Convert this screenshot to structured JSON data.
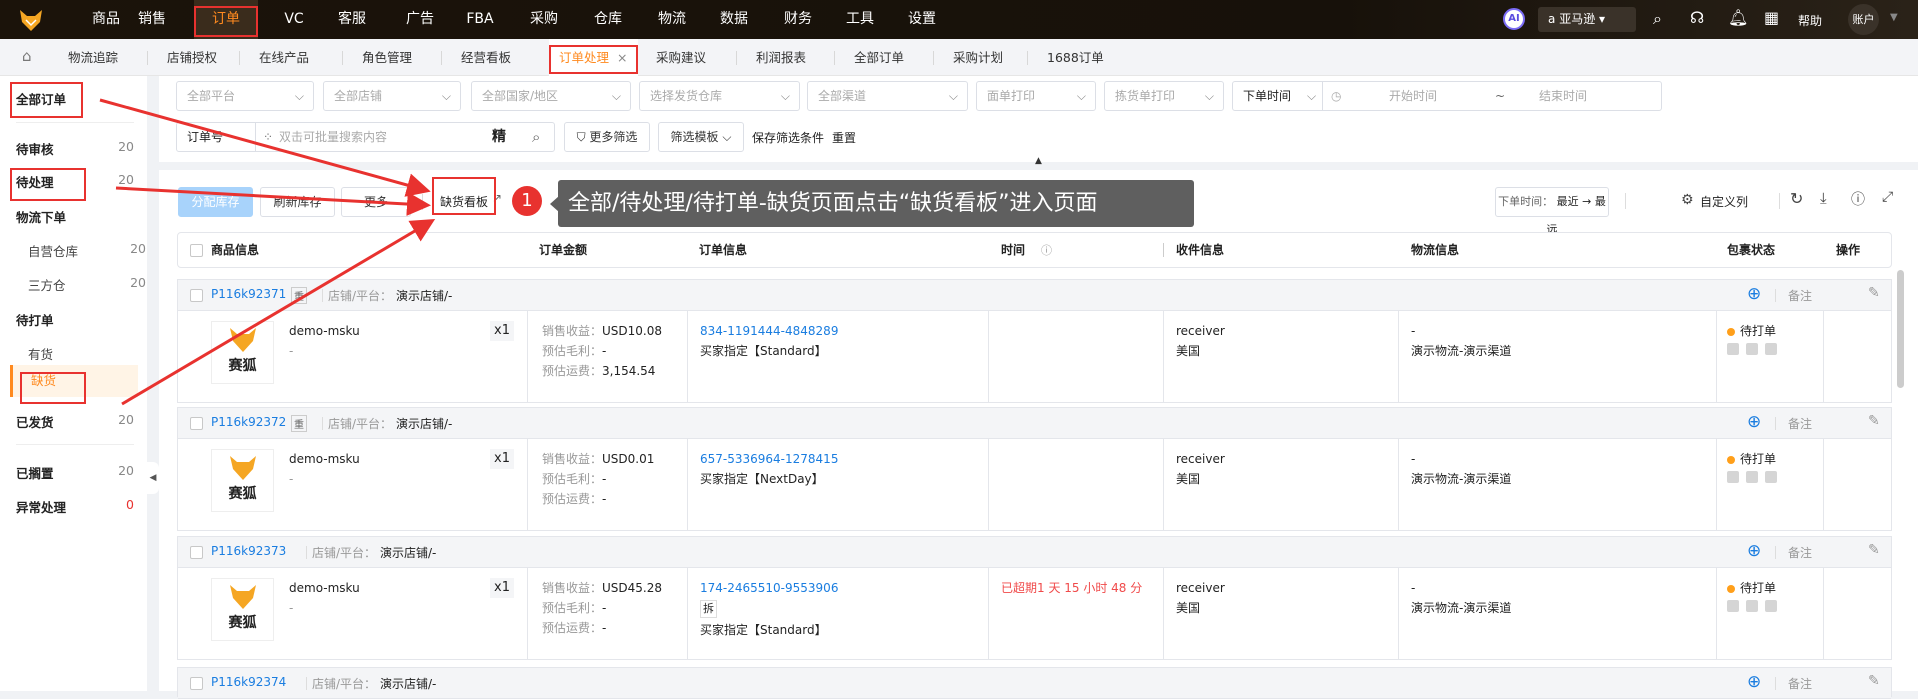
{
  "topnav": {
    "items": [
      "商品",
      "销售",
      "订单",
      "VC",
      "客服",
      "广告",
      "FBA",
      "采购",
      "仓库",
      "物流",
      "数据",
      "财务",
      "工具",
      "设置"
    ],
    "active": "订单",
    "ai": "AI",
    "platform": "亚马逊",
    "help": "帮助",
    "account": "账户"
  },
  "tabs": {
    "items": [
      "物流追踪",
      "店铺授权",
      "在线产品",
      "角色管理",
      "经营看板",
      "订单处理",
      "采购建议",
      "利润报表",
      "全部订单",
      "采购计划",
      "1688订单"
    ],
    "active": "订单处理",
    "close": "×"
  },
  "sidebar": {
    "items": [
      {
        "label": "全部订单",
        "count": ""
      },
      {
        "label": "待审核",
        "count": "20"
      },
      {
        "label": "待处理",
        "count": "20"
      },
      {
        "label": "物流下单",
        "count": ""
      },
      {
        "label": "自营仓库",
        "count": "20"
      },
      {
        "label": "三方仓",
        "count": "20"
      },
      {
        "label": "待打单",
        "count": ""
      },
      {
        "label": "有货",
        "count": ""
      },
      {
        "label": "缺货",
        "count": ""
      },
      {
        "label": "已发货",
        "count": "20"
      },
      {
        "label": "已搁置",
        "count": "20"
      },
      {
        "label": "异常处理",
        "count": "0"
      }
    ]
  },
  "filters": {
    "platform": "全部平台",
    "store": "全部店铺",
    "country": "全部国家/地区",
    "warehouse": "选择发货仓库",
    "channel": "全部渠道",
    "label_print": "面单打印",
    "pick_print": "拣货单打印",
    "time_type": "下单时间",
    "start": "开始时间",
    "tilde": "~",
    "end": "结束时间",
    "order_no": "订单号",
    "search_placeholder": "双击可批量搜索内容",
    "exact": "精",
    "more": "更多筛选",
    "template": "筛选模板",
    "save": "保存筛选条件",
    "reset": "重置"
  },
  "toolbar": {
    "allocate": "分配库存",
    "refresh": "刷新库存",
    "more": "更多",
    "shortage": "缺货看板",
    "sort_label": "下单时间：",
    "sort_value": "最近 → 最远",
    "custom_cols": "自定义列"
  },
  "table": {
    "headers": [
      "商品信息",
      "订单金额",
      "订单信息",
      "时间",
      "收件信息",
      "物流信息",
      "包裹状态",
      "操作"
    ]
  },
  "labels": {
    "store": "店铺/平台：",
    "revenue": "销售收益：",
    "profit": "预估毛利：",
    "shipping": "预估运费：",
    "note": "备注",
    "logo": "赛狐",
    "heavy": "重",
    "split": "拆"
  },
  "orders": [
    {
      "id": "P116k92371",
      "heavy": true,
      "store": "演示店铺/-",
      "sku": "demo-msku",
      "sub": "-",
      "qty": "x1",
      "revenue": "USD10.08",
      "profit": "-",
      "shipping": "3,154.54",
      "order_no": "834-1191444-4848289",
      "split": false,
      "service": "买家指定【Standard】",
      "time": "",
      "receiver": "receiver",
      "country": "美国",
      "logistics": "-",
      "channel": "演示物流-演示渠道",
      "status": "待打单"
    },
    {
      "id": "P116k92372",
      "heavy": true,
      "store": "演示店铺/-",
      "sku": "demo-msku",
      "sub": "-",
      "qty": "x1",
      "revenue": "USD0.01",
      "profit": "-",
      "shipping": "-",
      "order_no": "657-5336964-1278415",
      "split": false,
      "service": "买家指定【NextDay】",
      "time": "",
      "receiver": "receiver",
      "country": "美国",
      "logistics": "-",
      "channel": "演示物流-演示渠道",
      "status": "待打单"
    },
    {
      "id": "P116k92373",
      "heavy": false,
      "store": "演示店铺/-",
      "sku": "demo-msku",
      "sub": "-",
      "qty": "x1",
      "revenue": "USD45.28",
      "profit": "-",
      "shipping": "-",
      "order_no": "174-2465510-9553906",
      "split": true,
      "service": "买家指定【Standard】",
      "time": "已超期1 天 15 小时 48 分",
      "receiver": "receiver",
      "country": "美国",
      "logistics": "-",
      "channel": "演示物流-演示渠道",
      "status": "待打单"
    },
    {
      "id": "P116k92374",
      "heavy": false,
      "store": "演示店铺/-"
    }
  ],
  "annotation": {
    "step": "1",
    "text": "全部/待处理/待打单-缺货页面点击“缺货看板”进入页面"
  },
  "colors": {
    "accent": "#ff8a1f",
    "link": "#1a7de0",
    "annotation": "#e8322f",
    "overdue": "#f04a4a"
  }
}
